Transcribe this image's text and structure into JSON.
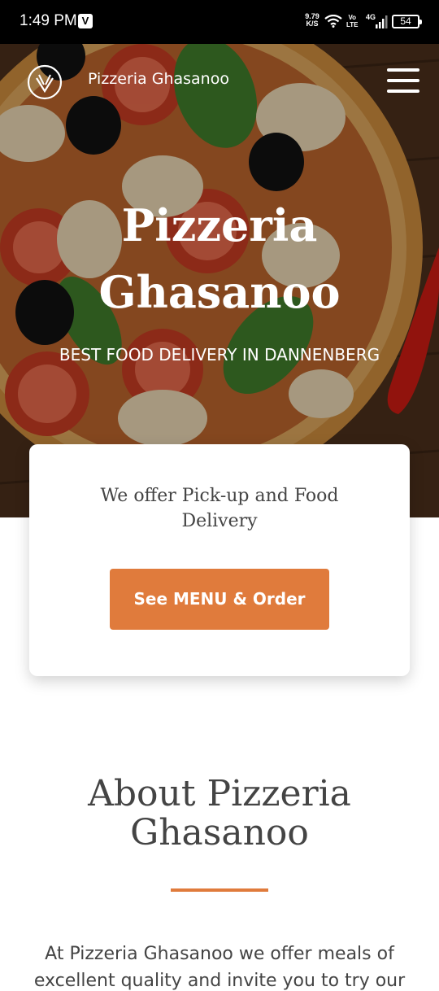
{
  "status_bar": {
    "time": "1:49 PM",
    "app_icon_letter": "V",
    "net_speed_value": "9.79",
    "net_speed_unit": "K/S",
    "volte_top": "Vo",
    "volte_bottom": "LTE",
    "network_type": "4G",
    "battery": "54"
  },
  "header": {
    "site_name": "Pizzeria Ghasanoo",
    "logo_icon": "cutlery-logo-icon",
    "menu_icon": "hamburger-menu-icon"
  },
  "hero": {
    "title": "Pizzeria Ghasanoo",
    "subtitle": "BEST FOOD DELIVERY IN DANNENBERG"
  },
  "offer_card": {
    "text": "We offer Pick-up and Food Delivery",
    "button_label": "See MENU & Order"
  },
  "about": {
    "title": "About Pizzeria Ghasanoo",
    "text": "At Pizzeria Ghasanoo we offer meals of excellent quality and invite you to try our"
  },
  "colors": {
    "accent": "#e07b3c",
    "text": "#444444"
  }
}
